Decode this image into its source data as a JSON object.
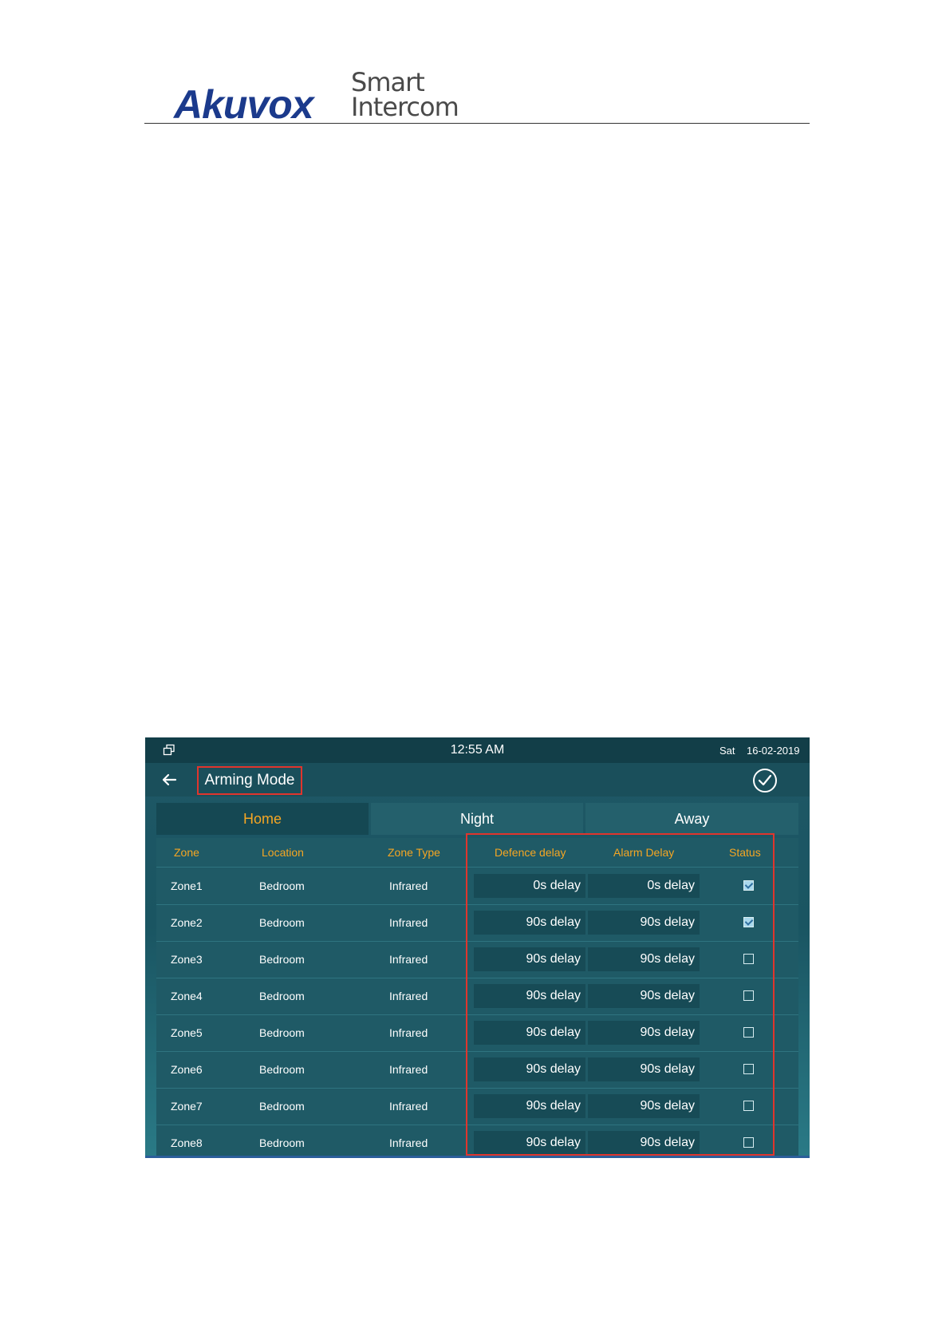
{
  "document": {
    "logo_brand": "Akuvox",
    "logo_line1": "Smart",
    "logo_line2": "Intercom"
  },
  "statusbar": {
    "time": "12:55 AM",
    "day": "Sat",
    "date": "16-02-2019",
    "window_icon": "window-restore-icon"
  },
  "appbar": {
    "title": "Arming Mode",
    "back_icon": "arrow-left-icon",
    "confirm_icon": "check-circle-icon"
  },
  "tabs": [
    {
      "label": "Home",
      "active": true
    },
    {
      "label": "Night",
      "active": false
    },
    {
      "label": "Away",
      "active": false
    }
  ],
  "table": {
    "headers": [
      "Zone",
      "Location",
      "Zone Type",
      "Defence delay",
      "Alarm Delay",
      "Status"
    ],
    "rows": [
      {
        "zone": "Zone1",
        "location": "Bedroom",
        "type": "Infrared",
        "defence": "0s delay",
        "alarm": "0s delay",
        "status": true
      },
      {
        "zone": "Zone2",
        "location": "Bedroom",
        "type": "Infrared",
        "defence": "90s delay",
        "alarm": "90s delay",
        "status": true
      },
      {
        "zone": "Zone3",
        "location": "Bedroom",
        "type": "Infrared",
        "defence": "90s delay",
        "alarm": "90s delay",
        "status": false
      },
      {
        "zone": "Zone4",
        "location": "Bedroom",
        "type": "Infrared",
        "defence": "90s delay",
        "alarm": "90s delay",
        "status": false
      },
      {
        "zone": "Zone5",
        "location": "Bedroom",
        "type": "Infrared",
        "defence": "90s delay",
        "alarm": "90s delay",
        "status": false
      },
      {
        "zone": "Zone6",
        "location": "Bedroom",
        "type": "Infrared",
        "defence": "90s delay",
        "alarm": "90s delay",
        "status": false
      },
      {
        "zone": "Zone7",
        "location": "Bedroom",
        "type": "Infrared",
        "defence": "90s delay",
        "alarm": "90s delay",
        "status": false
      },
      {
        "zone": "Zone8",
        "location": "Bedroom",
        "type": "Infrared",
        "defence": "90s delay",
        "alarm": "90s delay",
        "status": false
      }
    ]
  },
  "colors": {
    "accent": "#f5a623",
    "highlight": "#e0352d",
    "brand": "#1b3a8c"
  }
}
